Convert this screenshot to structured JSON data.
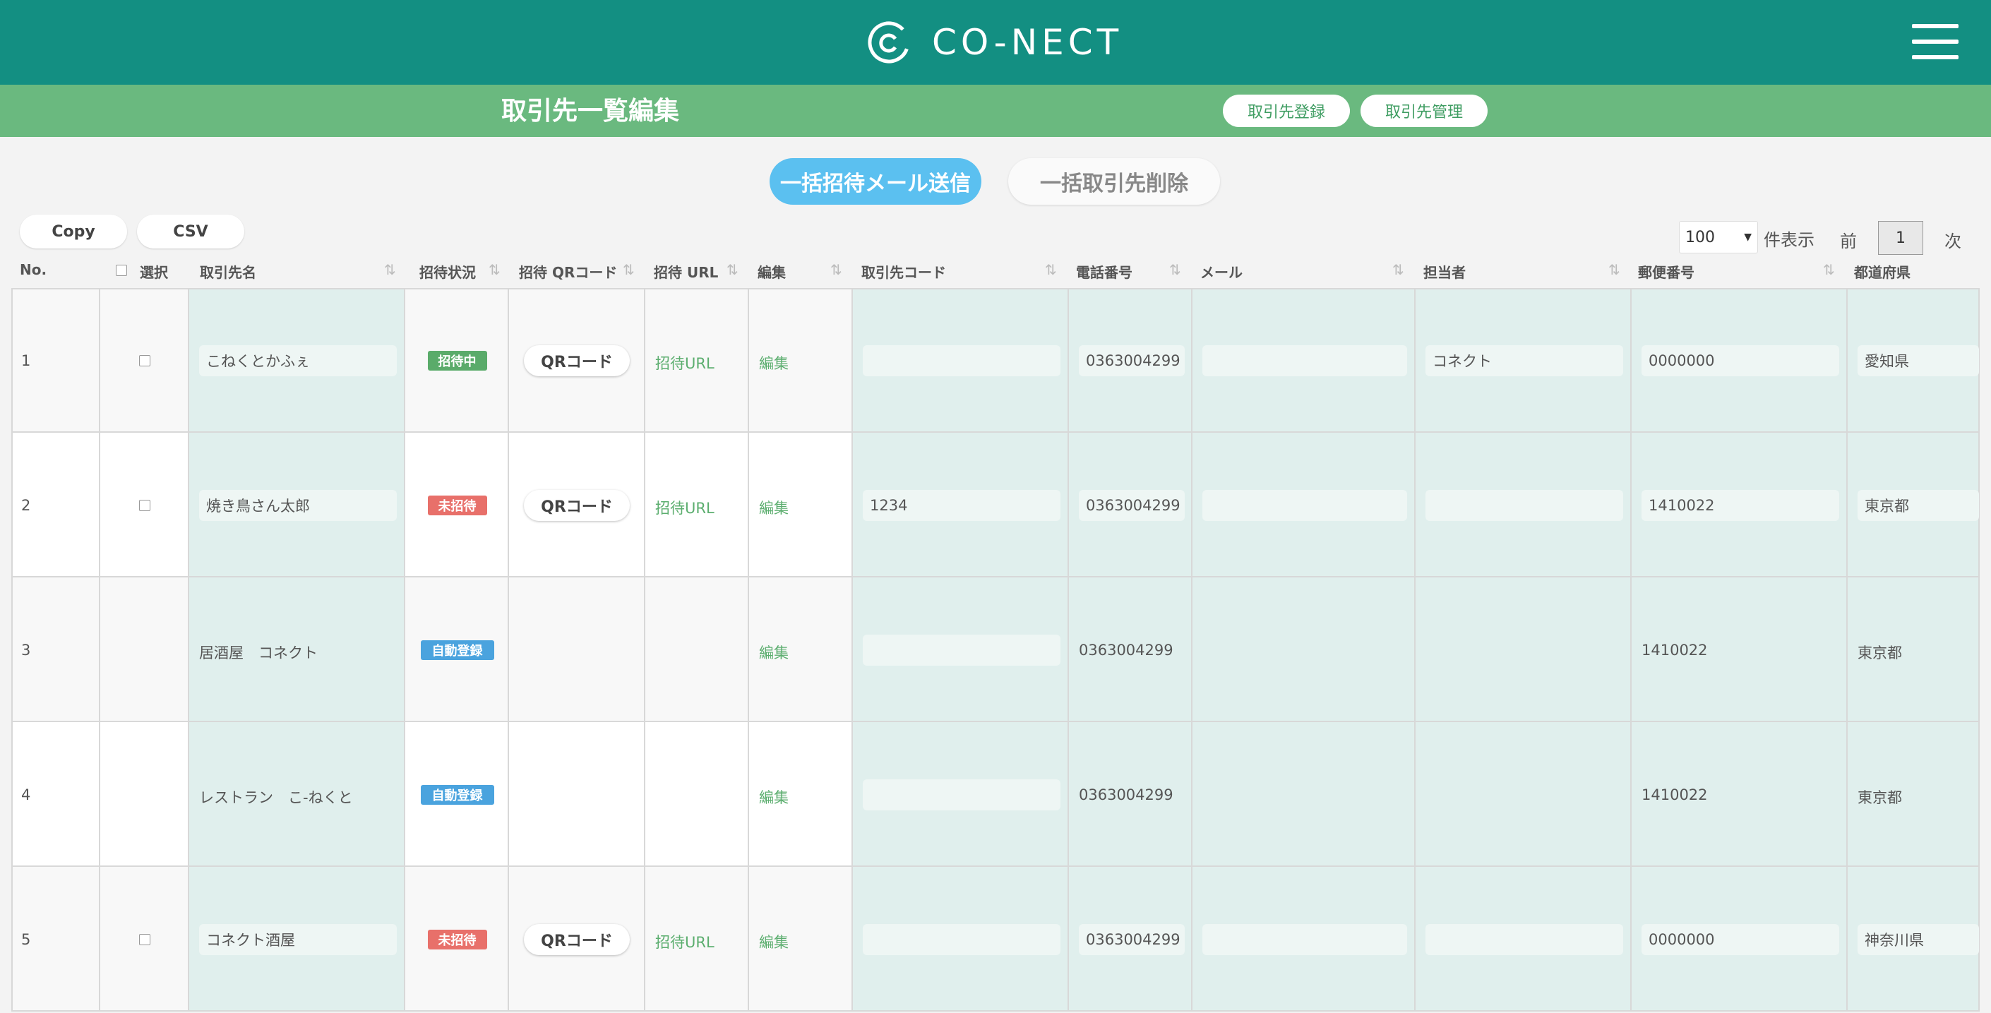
{
  "brand": {
    "name": "CO-NECT",
    "logo_icon": "co-nect-logo-icon"
  },
  "header": {
    "title": "取引先一覧編集",
    "register_label": "取引先登録",
    "manage_label": "取引先管理"
  },
  "actions": {
    "bulk_invite_label": "一括招待メール送信",
    "bulk_delete_label": "一括取引先削除",
    "copy_label": "Copy",
    "csv_label": "CSV"
  },
  "pager": {
    "per_page": "100",
    "per_page_suffix": "件表示",
    "prev": "前",
    "current": "1",
    "next": "次"
  },
  "table": {
    "headers": {
      "no": "No.",
      "select": "選択",
      "name": "取引先名",
      "status": "招待状況",
      "qr": "招待 QRコード",
      "url": "招待 URL",
      "edit": "編集",
      "code": "取引先コード",
      "phone": "電話番号",
      "mail": "メール",
      "person": "担当者",
      "zip": "郵便番号",
      "pref": "都道府県"
    },
    "qr_label": "QRコード",
    "url_label": "招待URL",
    "edit_label": "編集",
    "rows": [
      {
        "no": "1",
        "name": "こねくとかふぇ",
        "status": "招待中",
        "code": "",
        "phone": "0363004299",
        "mail": "",
        "person": "コネクト",
        "zip": "0000000",
        "pref": "愛知県"
      },
      {
        "no": "2",
        "name": "焼き鳥さん太郎",
        "status": "未招待",
        "code": "1234",
        "phone": "0363004299",
        "mail": "",
        "person": "",
        "zip": "1410022",
        "pref": "東京都"
      },
      {
        "no": "3",
        "name": "居酒屋　コネクト",
        "status": "自動登録",
        "code": "",
        "phone": "0363004299",
        "mail": "",
        "person": "",
        "zip": "1410022",
        "pref": "東京都"
      },
      {
        "no": "4",
        "name": "レストラン　こ-ねくと",
        "status": "自動登録",
        "code": "",
        "phone": "0363004299",
        "mail": "",
        "person": "",
        "zip": "1410022",
        "pref": "東京都"
      },
      {
        "no": "5",
        "name": "コネクト酒屋",
        "status": "未招待",
        "code": "",
        "phone": "0363004299",
        "mail": "",
        "person": "",
        "zip": "0000000",
        "pref": "神奈川県"
      }
    ]
  },
  "colors": {
    "topbar": "#138f82",
    "subbar": "#6ab97f",
    "invite_button": "#5bc0f0",
    "status_inviting": "#5aab6a",
    "status_not_invited": "#e8706a",
    "status_auto": "#4aa3de",
    "link": "#5cae6f"
  }
}
